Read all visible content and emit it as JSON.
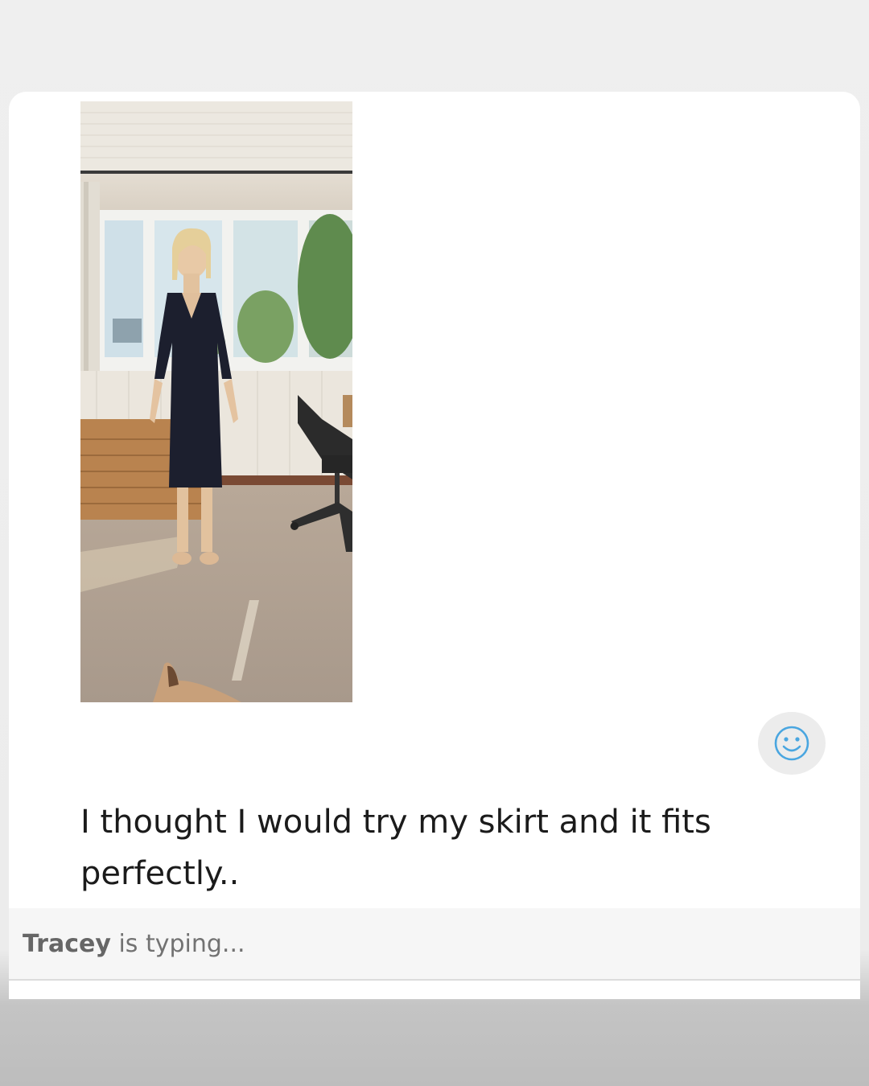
{
  "message": {
    "photo_description_icon": "photo-icon",
    "text": "I thought I would try my skirt and it fits perfectly..",
    "reaction_icon": "smiley-icon",
    "reaction_color": "#4aa6e0"
  },
  "typing": {
    "name": "Tracey",
    "status": "is typing..."
  }
}
